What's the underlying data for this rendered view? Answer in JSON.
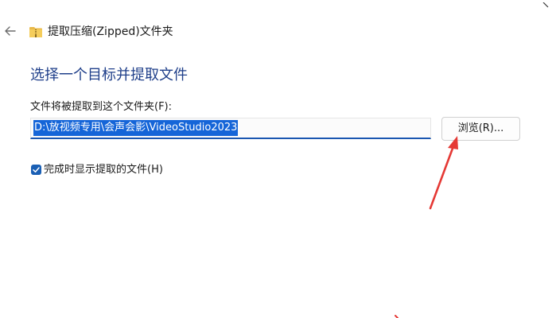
{
  "window": {
    "title": "提取压缩(Zipped)文件夹"
  },
  "main": {
    "heading": "选择一个目标并提取文件",
    "field_label": "文件将被提取到这个文件夹(F):",
    "path_value": "D:\\放视频专用\\会声会影\\VideoStudio2023",
    "browse_label": "浏览(R)...",
    "show_files_label": "完成时显示提取的文件(H)",
    "show_files_checked": true
  },
  "colors": {
    "accent": "#1a5fb4",
    "heading": "#1f3f8a",
    "annotation_arrow": "#e53935"
  }
}
